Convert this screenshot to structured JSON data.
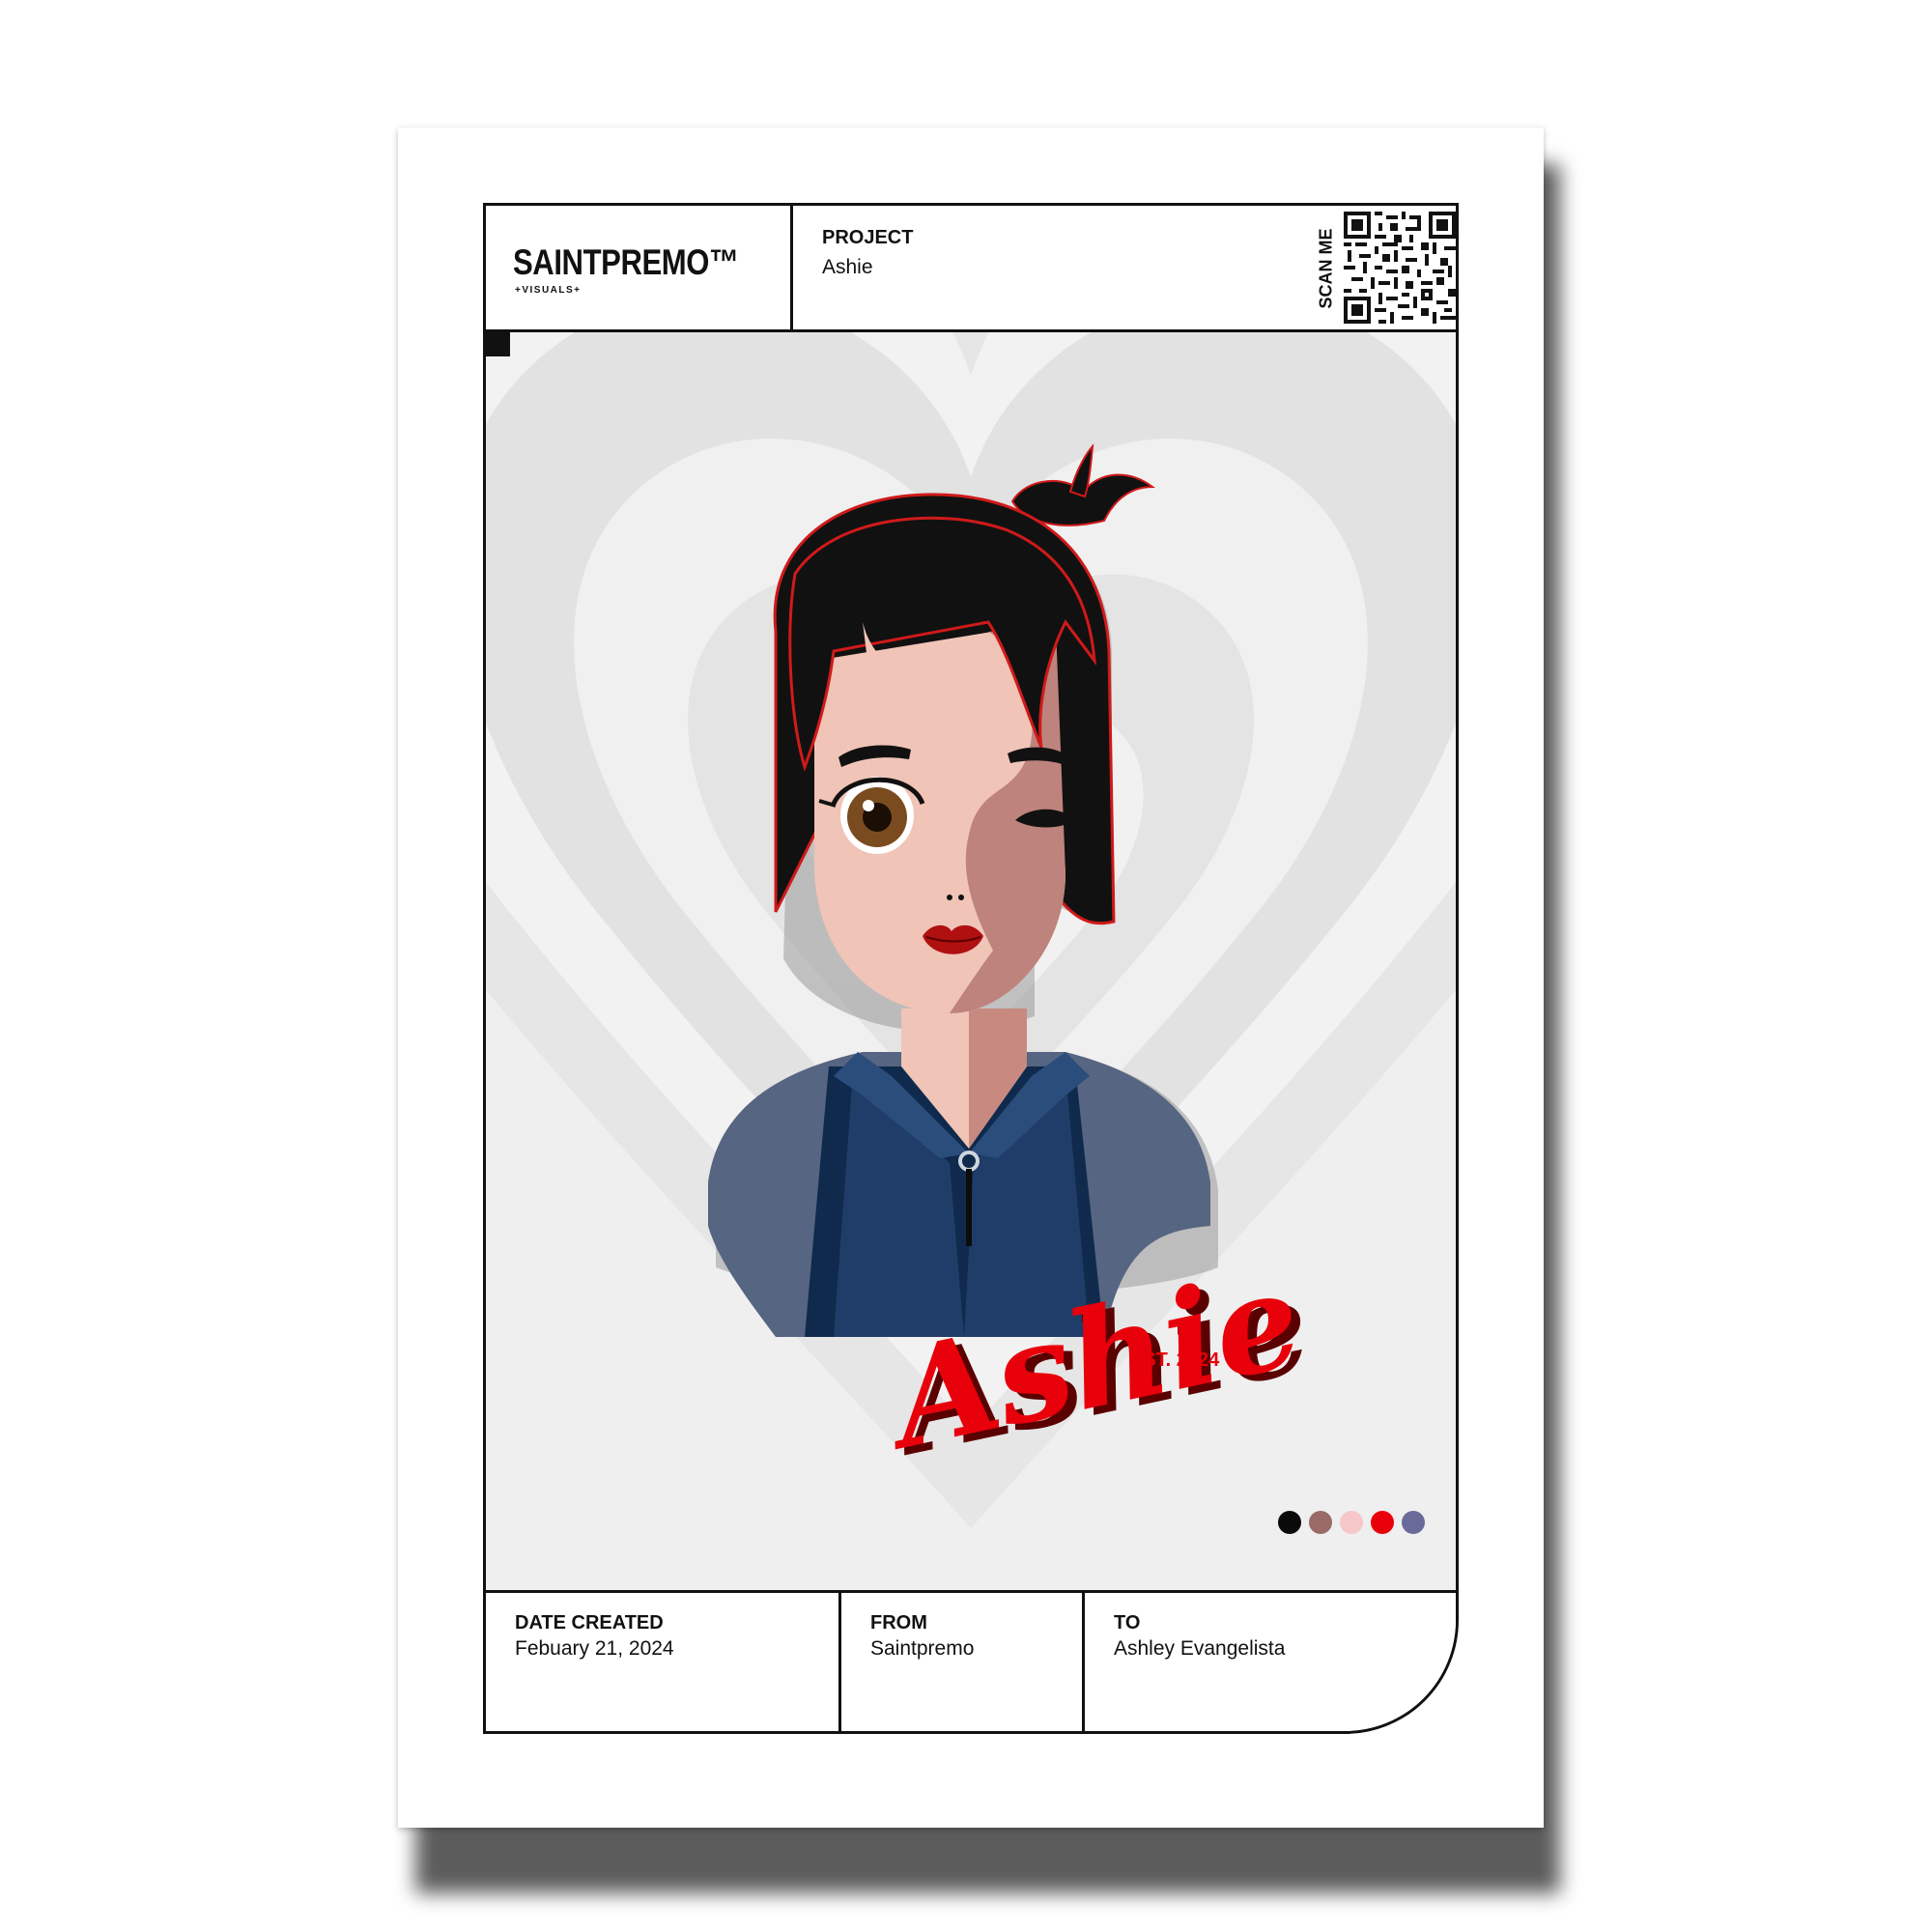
{
  "header": {
    "brand_name": "SAINTPREMO™",
    "brand_sub": "+VISUALS+",
    "project_label": "PROJECT",
    "project_value": "Ashie",
    "scan_label": "SCAN ME"
  },
  "artwork": {
    "title_script": "Ashie",
    "established": "EST. 2024"
  },
  "footer": {
    "date_label": "DATE CREATED",
    "date_value": "Febuary 21, 2024",
    "from_label": "FROM",
    "from_value": "Saintpremo",
    "to_label": "TO",
    "to_value": "Ashley Evangelista"
  },
  "palette": [
    "#0a0a0a",
    "#9a6a66",
    "#f6c7c9",
    "#e8000a",
    "#6a6a9a"
  ],
  "icons": {
    "qr": "qr-code-icon"
  }
}
